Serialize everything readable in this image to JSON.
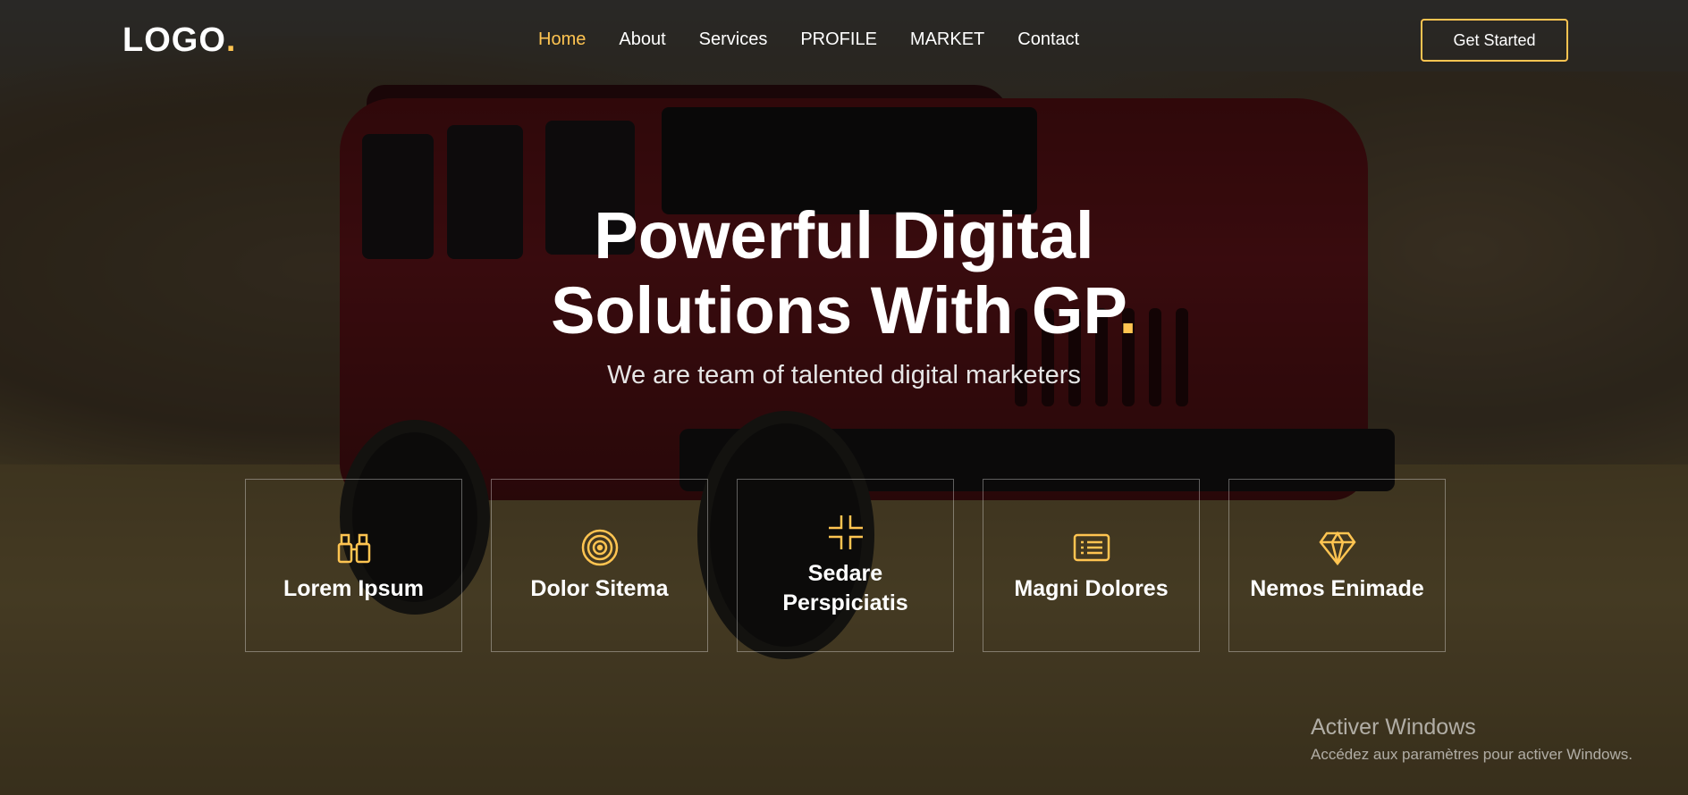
{
  "header": {
    "logo_text": "LOGO",
    "logo_dot": ".",
    "nav": [
      "Home",
      "About",
      "Services",
      "PROFILE",
      "MARKET",
      "Contact"
    ],
    "cta_label": "Get Started"
  },
  "hero": {
    "title_line1": "Powerful Digital",
    "title_line2": "Solutions With GP",
    "title_dot": ".",
    "subtitle": "We are team of talented digital marketers"
  },
  "features": [
    {
      "icon": "binoculars-icon",
      "label": "Lorem Ipsum"
    },
    {
      "icon": "target-icon",
      "label": "Dolor Sitema"
    },
    {
      "icon": "collapse-arrows-icon",
      "label": "Sedare Perspiciatis"
    },
    {
      "icon": "list-icon",
      "label": "Magni Dolores"
    },
    {
      "icon": "gem-icon",
      "label": "Nemos Enimade"
    }
  ],
  "watermark": {
    "title": "Activer Windows",
    "subtitle": "Accédez aux paramètres pour activer Windows."
  },
  "colors": {
    "accent": "#ffc451",
    "text": "#ffffff"
  }
}
